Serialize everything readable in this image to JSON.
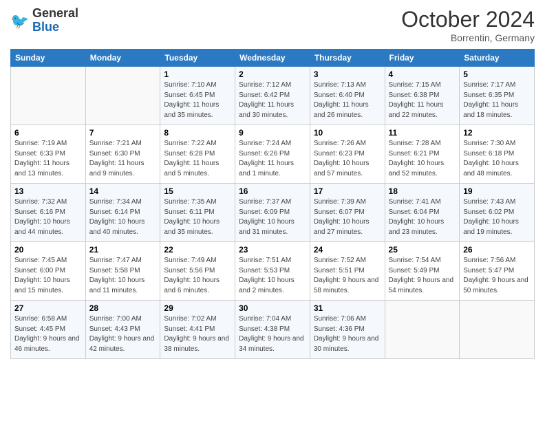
{
  "header": {
    "logo_line1": "General",
    "logo_line2": "Blue",
    "month": "October 2024",
    "location": "Borrentin, Germany"
  },
  "weekdays": [
    "Sunday",
    "Monday",
    "Tuesday",
    "Wednesday",
    "Thursday",
    "Friday",
    "Saturday"
  ],
  "weeks": [
    [
      {
        "day": "",
        "info": ""
      },
      {
        "day": "",
        "info": ""
      },
      {
        "day": "1",
        "info": "Sunrise: 7:10 AM\nSunset: 6:45 PM\nDaylight: 11 hours and 35 minutes."
      },
      {
        "day": "2",
        "info": "Sunrise: 7:12 AM\nSunset: 6:42 PM\nDaylight: 11 hours and 30 minutes."
      },
      {
        "day": "3",
        "info": "Sunrise: 7:13 AM\nSunset: 6:40 PM\nDaylight: 11 hours and 26 minutes."
      },
      {
        "day": "4",
        "info": "Sunrise: 7:15 AM\nSunset: 6:38 PM\nDaylight: 11 hours and 22 minutes."
      },
      {
        "day": "5",
        "info": "Sunrise: 7:17 AM\nSunset: 6:35 PM\nDaylight: 11 hours and 18 minutes."
      }
    ],
    [
      {
        "day": "6",
        "info": "Sunrise: 7:19 AM\nSunset: 6:33 PM\nDaylight: 11 hours and 13 minutes."
      },
      {
        "day": "7",
        "info": "Sunrise: 7:21 AM\nSunset: 6:30 PM\nDaylight: 11 hours and 9 minutes."
      },
      {
        "day": "8",
        "info": "Sunrise: 7:22 AM\nSunset: 6:28 PM\nDaylight: 11 hours and 5 minutes."
      },
      {
        "day": "9",
        "info": "Sunrise: 7:24 AM\nSunset: 6:26 PM\nDaylight: 11 hours and 1 minute."
      },
      {
        "day": "10",
        "info": "Sunrise: 7:26 AM\nSunset: 6:23 PM\nDaylight: 10 hours and 57 minutes."
      },
      {
        "day": "11",
        "info": "Sunrise: 7:28 AM\nSunset: 6:21 PM\nDaylight: 10 hours and 52 minutes."
      },
      {
        "day": "12",
        "info": "Sunrise: 7:30 AM\nSunset: 6:18 PM\nDaylight: 10 hours and 48 minutes."
      }
    ],
    [
      {
        "day": "13",
        "info": "Sunrise: 7:32 AM\nSunset: 6:16 PM\nDaylight: 10 hours and 44 minutes."
      },
      {
        "day": "14",
        "info": "Sunrise: 7:34 AM\nSunset: 6:14 PM\nDaylight: 10 hours and 40 minutes."
      },
      {
        "day": "15",
        "info": "Sunrise: 7:35 AM\nSunset: 6:11 PM\nDaylight: 10 hours and 35 minutes."
      },
      {
        "day": "16",
        "info": "Sunrise: 7:37 AM\nSunset: 6:09 PM\nDaylight: 10 hours and 31 minutes."
      },
      {
        "day": "17",
        "info": "Sunrise: 7:39 AM\nSunset: 6:07 PM\nDaylight: 10 hours and 27 minutes."
      },
      {
        "day": "18",
        "info": "Sunrise: 7:41 AM\nSunset: 6:04 PM\nDaylight: 10 hours and 23 minutes."
      },
      {
        "day": "19",
        "info": "Sunrise: 7:43 AM\nSunset: 6:02 PM\nDaylight: 10 hours and 19 minutes."
      }
    ],
    [
      {
        "day": "20",
        "info": "Sunrise: 7:45 AM\nSunset: 6:00 PM\nDaylight: 10 hours and 15 minutes."
      },
      {
        "day": "21",
        "info": "Sunrise: 7:47 AM\nSunset: 5:58 PM\nDaylight: 10 hours and 11 minutes."
      },
      {
        "day": "22",
        "info": "Sunrise: 7:49 AM\nSunset: 5:56 PM\nDaylight: 10 hours and 6 minutes."
      },
      {
        "day": "23",
        "info": "Sunrise: 7:51 AM\nSunset: 5:53 PM\nDaylight: 10 hours and 2 minutes."
      },
      {
        "day": "24",
        "info": "Sunrise: 7:52 AM\nSunset: 5:51 PM\nDaylight: 9 hours and 58 minutes."
      },
      {
        "day": "25",
        "info": "Sunrise: 7:54 AM\nSunset: 5:49 PM\nDaylight: 9 hours and 54 minutes."
      },
      {
        "day": "26",
        "info": "Sunrise: 7:56 AM\nSunset: 5:47 PM\nDaylight: 9 hours and 50 minutes."
      }
    ],
    [
      {
        "day": "27",
        "info": "Sunrise: 6:58 AM\nSunset: 4:45 PM\nDaylight: 9 hours and 46 minutes."
      },
      {
        "day": "28",
        "info": "Sunrise: 7:00 AM\nSunset: 4:43 PM\nDaylight: 9 hours and 42 minutes."
      },
      {
        "day": "29",
        "info": "Sunrise: 7:02 AM\nSunset: 4:41 PM\nDaylight: 9 hours and 38 minutes."
      },
      {
        "day": "30",
        "info": "Sunrise: 7:04 AM\nSunset: 4:38 PM\nDaylight: 9 hours and 34 minutes."
      },
      {
        "day": "31",
        "info": "Sunrise: 7:06 AM\nSunset: 4:36 PM\nDaylight: 9 hours and 30 minutes."
      },
      {
        "day": "",
        "info": ""
      },
      {
        "day": "",
        "info": ""
      }
    ]
  ]
}
